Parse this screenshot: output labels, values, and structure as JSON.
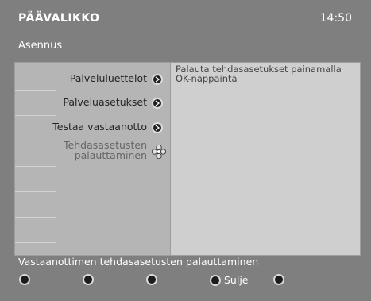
{
  "header": {
    "title": "PÄÄVALIKKO",
    "time": "14:50"
  },
  "section": {
    "title": "Asennus"
  },
  "menu": {
    "items": [
      {
        "label": "Palveluluettelot"
      },
      {
        "label": "Palveluasetukset"
      },
      {
        "label": "Testaa vastaanotto"
      },
      {
        "label_line1": "Tehdasasetusten",
        "label_line2": "palauttaminen"
      }
    ]
  },
  "info": {
    "text": "Palauta tehdasasetukset painamalla OK-näppäintä"
  },
  "footer": {
    "status": "Vastaanottimen tehdasasetusten palauttaminen",
    "buttons": [
      {
        "label": ""
      },
      {
        "label": ""
      },
      {
        "label": ""
      },
      {
        "label": "Sulje"
      },
      {
        "label": ""
      }
    ]
  }
}
